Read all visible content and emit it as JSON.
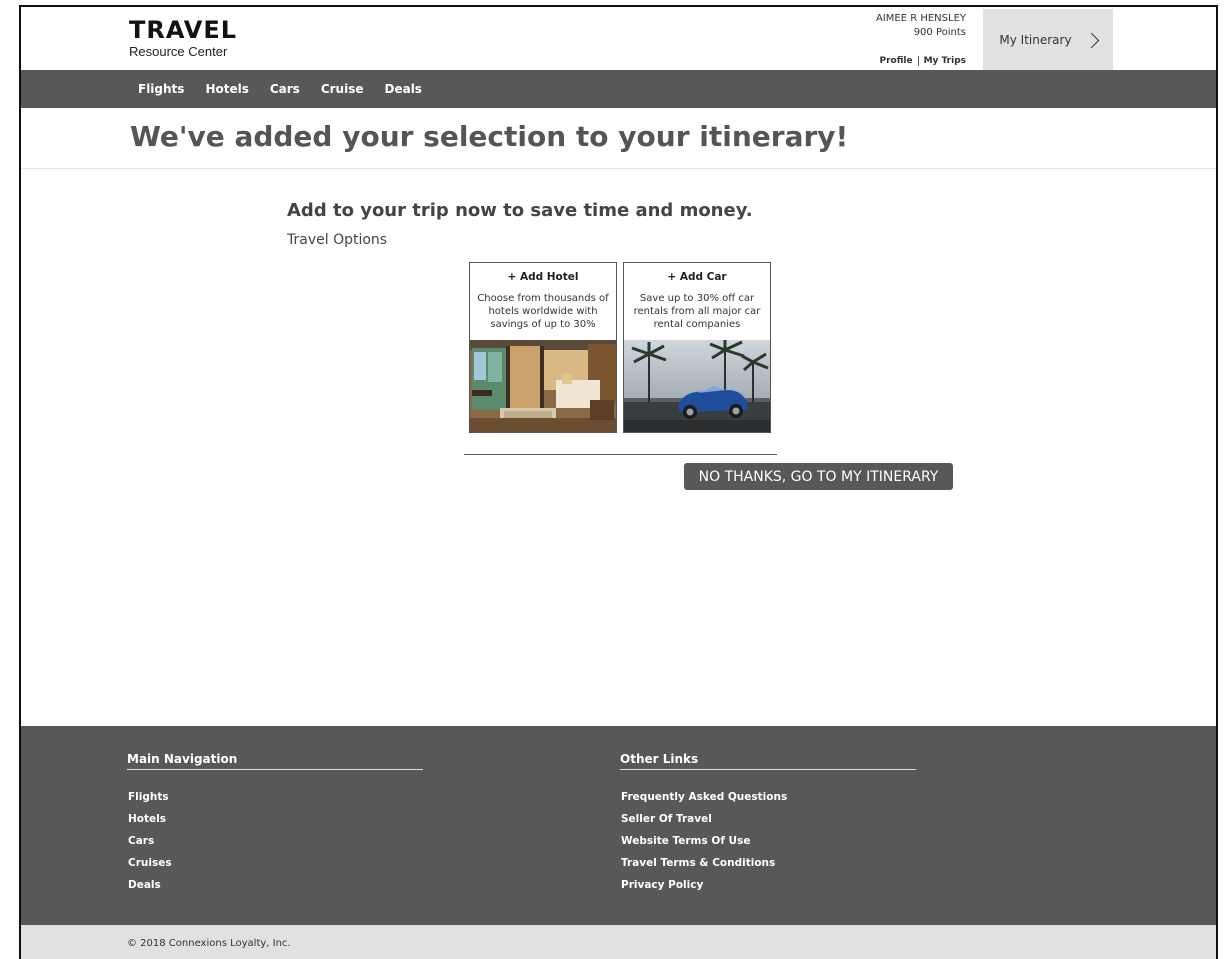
{
  "brand": {
    "title": "TRAVEL",
    "subtitle": "Resource Center"
  },
  "user": {
    "name": "AIMEE R HENSLEY",
    "points": "900 Points",
    "profile_link": "Profile",
    "trips_link": "My Trips"
  },
  "itinerary_button": {
    "label": "My Itinerary",
    "icon": "chevron-right-icon"
  },
  "nav": {
    "items": [
      "Flights",
      "Hotels",
      "Cars",
      "Cruise",
      "Deals"
    ]
  },
  "page": {
    "title": "We've added your selection to your itinerary!"
  },
  "promo": {
    "heading": "Add to your trip now to save time and money.",
    "options_label": "Travel Options",
    "cards": [
      {
        "title": "+ Add Hotel",
        "description": "Choose from thousands of hotels worldwide with savings of up to 30%"
      },
      {
        "title": "+ Add Car",
        "description": "Save up to 30% off car rentals from all major car rental companies"
      }
    ]
  },
  "no_thanks": {
    "label": "NO THANKS, GO TO MY ITINERARY"
  },
  "footer": {
    "main_nav": {
      "heading": "Main Navigation",
      "items": [
        "Flights",
        "Hotels",
        "Cars",
        "Cruises",
        "Deals"
      ]
    },
    "other_links": {
      "heading": "Other Links",
      "items": [
        "Frequently Asked Questions",
        "Seller Of Travel",
        "Website Terms Of Use",
        "Travel Terms & Conditions",
        "Privacy Policy"
      ]
    }
  },
  "copyright": "© 2018 Connexions Loyalty, Inc.",
  "colors": {
    "nav_bg": "#585858",
    "footer_bg": "#585858",
    "itinerary_bg": "#e1e1e1",
    "copyright_bg": "#e1e1e1"
  }
}
